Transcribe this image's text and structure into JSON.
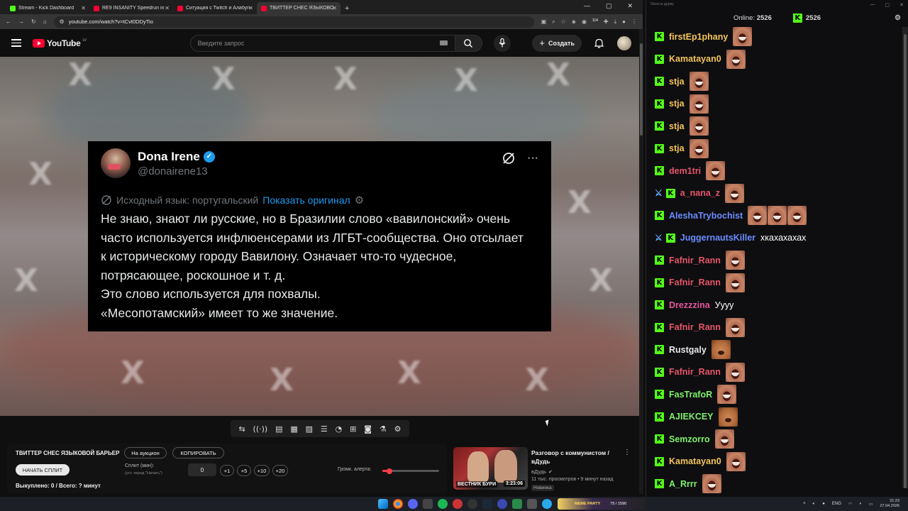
{
  "browser": {
    "tabs": [
      {
        "title": "Stream - Kick Dashboard",
        "icon": "kick-icon",
        "color": "#53fc18"
      },
      {
        "title": "RE9 INSANITY Speedrun in 1:3",
        "icon": "youtube-icon",
        "color": "#ff0033"
      },
      {
        "title": "Ситуация с Twitch и Алабугой",
        "icon": "youtube-icon",
        "color": "#ff0033"
      },
      {
        "title": "ТВИТТЕР СНЕС ЯЗЫКОВОЙ",
        "icon": "youtube-icon",
        "color": "#ff0033",
        "active": true
      }
    ],
    "url": "youtube.com/watch?v=tCvt0DDyTio",
    "ext_badge": "114"
  },
  "youtube": {
    "logo": "YouTube",
    "region": "LV",
    "search_placeholder": "Введите запрос",
    "create_label": "Создать"
  },
  "tweet": {
    "name": "Dona Irene",
    "handle": "@donairene13",
    "lang_note": "Исходный язык: португальский",
    "show_original": "Показать оригинал",
    "lines": [
      "Не знаю, знают ли русские, но в Бразилии слово «вавилонский» очень",
      "часто используется инфлюенсерами из ЛГБТ-сообщества. Оно отсылает",
      "к историческому городу Вавилону. Означает что-то чудесное,",
      "потрясающее, роскошное и т. д.",
      "Это слово используется для похвалы.",
      "«Месопотамский» имеет то же значение."
    ]
  },
  "panel": {
    "title": "ТВИТТЕР СНЕС ЯЗЫКОВОЙ БАРЬЕР",
    "auction_label": "На аукцион",
    "copy_label": "КОПИРОВАТЬ",
    "start_split_label": "НАЧАТЬ СПЛИТ",
    "split_label": "Сплит (мин):",
    "split_hint": "(уст. перед \"Начать\")",
    "split_value": "0",
    "increments": [
      "+1",
      "+5",
      "+10",
      "+20"
    ],
    "alert_volume_label": "Громк. алерта:",
    "alert_volume": 0.12,
    "totals": "Выкуплено: 0 / Всего: ? минут"
  },
  "recommendation": {
    "title": "Разговор с коммунистом / вДудь",
    "channel": "вДудь",
    "meta": "11 тыс. просмотров • 9 минут назад",
    "badge": "Новинка",
    "thumb_caption": "ВЕСТНИК БУРИ",
    "duration": "3:23:06"
  },
  "chat": {
    "window_title": "Окно в дурку",
    "online_label": "Online:",
    "online_count": "2526",
    "kick_count": "2526",
    "messages": [
      {
        "user": "firstEp1phany",
        "color": "#f4c45a",
        "emotes": 1,
        "text": ""
      },
      {
        "user": "Kamatayan0",
        "color": "#f4c45a",
        "emotes": 1,
        "text": ""
      },
      {
        "user": "stja",
        "color": "#f4c45a",
        "emotes": 1,
        "text": ""
      },
      {
        "user": "stja",
        "color": "#f4c45a",
        "emotes": 1,
        "text": ""
      },
      {
        "user": "stja",
        "color": "#f4c45a",
        "emotes": 1,
        "text": ""
      },
      {
        "user": "stja",
        "color": "#f4c45a",
        "emotes": 1,
        "text": ""
      },
      {
        "user": "dem1tri",
        "color": "#e5556a",
        "emotes": 1,
        "text": ""
      },
      {
        "user": "a_nana_z",
        "color": "#e5556a",
        "emotes": 1,
        "text": "",
        "badge": true
      },
      {
        "user": "AleshaTrybochist",
        "color": "#6a8cff",
        "emotes": 3,
        "text": ""
      },
      {
        "user": "JuggernautsKiller",
        "color": "#6a8cff",
        "emotes": 0,
        "text": "хкахахахах",
        "badge": true
      },
      {
        "user": "Fafnir_Rann",
        "color": "#e5556a",
        "emotes": 1,
        "text": ""
      },
      {
        "user": "Fafnir_Rann",
        "color": "#e5556a",
        "emotes": 1,
        "text": ""
      },
      {
        "user": "Drezzzina",
        "color": "#e5559a",
        "emotes": 0,
        "text": "Уууу"
      },
      {
        "user": "Fafnir_Rann",
        "color": "#e5556a",
        "emotes": 1,
        "text": ""
      },
      {
        "user": "Rustgaly",
        "color": "#e8e8e8",
        "emotes": 1,
        "text": "",
        "alt": true
      },
      {
        "user": "Fafnir_Rann",
        "color": "#e5556a",
        "emotes": 1,
        "text": ""
      },
      {
        "user": "FasTrafoR",
        "color": "#7ef06a",
        "emotes": 1,
        "text": ""
      },
      {
        "user": "AJIEKCEY",
        "color": "#7ef06a",
        "emotes": 1,
        "text": "",
        "alt": true
      },
      {
        "user": "Semzorro",
        "color": "#7ef06a",
        "emotes": 1,
        "text": ""
      },
      {
        "user": "Kamatayan0",
        "color": "#f4c45a",
        "emotes": 1,
        "text": ""
      },
      {
        "user": "A_Rrrr",
        "color": "#7ef06a",
        "emotes": 1,
        "text": ""
      }
    ]
  },
  "taskbar": {
    "promo_title": "MEME PARTY",
    "promo_count": "75 / 1590",
    "lang": "ENG",
    "time": "21:23",
    "date": "27.04.2026"
  }
}
